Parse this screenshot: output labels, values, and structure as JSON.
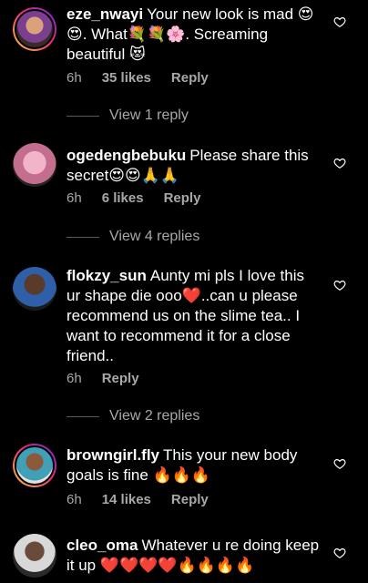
{
  "comments": [
    {
      "username": "eze_nwayi",
      "text": "Your new look is mad 😍😍. What💐💐🌸. Screaming beautiful 😻",
      "time": "6h",
      "likes": "35 likes",
      "reply": "Reply",
      "view_replies": "View 1 reply"
    },
    {
      "username": "ogedengbebuku",
      "text": "Please share this secret😍😍🙏🙏",
      "time": "6h",
      "likes": "6 likes",
      "reply": "Reply",
      "view_replies": "View 4 replies"
    },
    {
      "username": "flokzy_sun",
      "text": "Aunty mi pls I love this ur shape die ooo❤️..can u please recommend us on the slime tea.. I want to recommend it for a close friend..",
      "time": "6h",
      "reply": "Reply",
      "view_replies": "View 2 replies"
    },
    {
      "username": "browngirl.fly",
      "text": "This your new body goals is fine 🔥🔥🔥",
      "time": "6h",
      "likes": "14 likes",
      "reply": "Reply"
    },
    {
      "username": "cleo_oma",
      "text": "Whatever u re doing keep it up ❤️❤️❤️❤️🔥🔥🔥🔥"
    }
  ],
  "icons": {
    "like": "heart-outline-icon"
  },
  "colors": {
    "background": "#000000",
    "text": "#ffffff",
    "secondary": "#a8a8a8"
  }
}
